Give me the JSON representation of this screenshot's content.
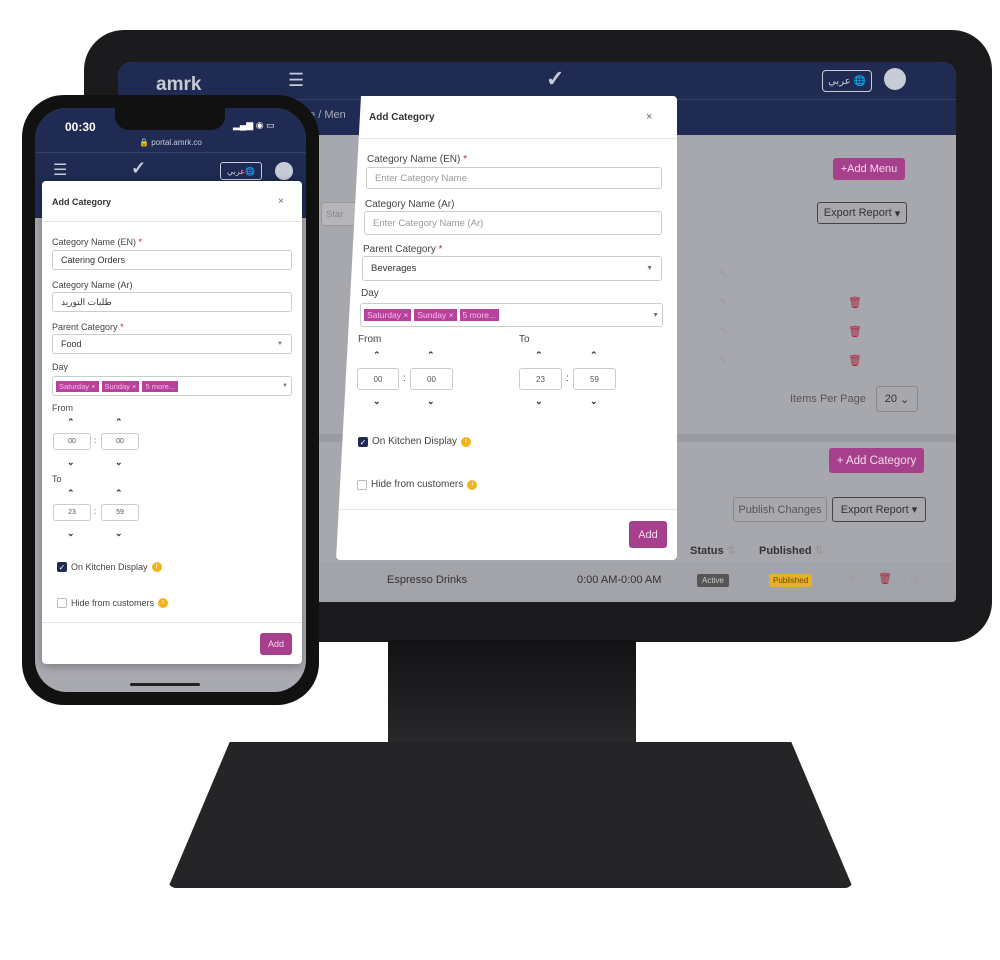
{
  "tablet": {
    "brand": "amrk",
    "lang_button": "عربي",
    "breadcrumb": "fe / Men",
    "add_menu": "+Add Menu",
    "export_report": "Export Report",
    "search_placeholder": "Star",
    "items_per_page_label": "Items Per Page",
    "items_per_page": "20",
    "add_category": "+ Add Category",
    "publish_changes": "Publish Changes",
    "export_report_2": "Export Report",
    "columns": {
      "status": "Status",
      "published": "Published"
    },
    "row": {
      "name": "Espresso Drinks",
      "time": "0:00 AM-0:00 AM",
      "status": "Active",
      "published": "Published"
    },
    "modal": {
      "title": "Add Category",
      "close": "×",
      "name_en_label": "Category Name (EN)",
      "name_en_placeholder": "Enter Category Name",
      "name_ar_label": "Category Name (Ar)",
      "name_ar_placeholder": "Enter Category Name (Ar)",
      "parent_label": "Parent Category",
      "parent_value": "Beverages",
      "day_label": "Day",
      "days": [
        "Saturday",
        "Sunday"
      ],
      "more": "5 more...",
      "from_label": "From",
      "from_h": "00",
      "from_m": "00",
      "to_label": "To",
      "to_h": "23",
      "to_m": "59",
      "kitchen_label": "On Kitchen Display",
      "kitchen_checked": true,
      "hide_label": "Hide from customers",
      "hide_checked": false,
      "add": "Add"
    }
  },
  "phone": {
    "time": "00:30",
    "url": "portal.amrk.co",
    "lang_button": "عربي",
    "modal": {
      "title": "Add Category",
      "close": "×",
      "name_en_label": "Category Name (EN)",
      "name_en_value": "Catering Orders",
      "name_ar_label": "Category Name (Ar)",
      "name_ar_value": "طلبات التوريد",
      "parent_label": "Parent Category",
      "parent_value": "Food",
      "day_label": "Day",
      "days": [
        "Saturday",
        "Sunday"
      ],
      "more": "5 more...",
      "from_label": "From",
      "from_h": "00",
      "from_m": "00",
      "to_label": "To",
      "to_h": "23",
      "to_m": "59",
      "kitchen_label": "On Kitchen Display",
      "kitchen_checked": true,
      "hide_label": "Hide from customers",
      "hide_checked": false,
      "add": "Add"
    }
  },
  "colors": {
    "navy": "#1f2b52",
    "accent": "#a63f8c",
    "info": "#f3b41b",
    "active": "#555",
    "published": "#e6b12a"
  }
}
